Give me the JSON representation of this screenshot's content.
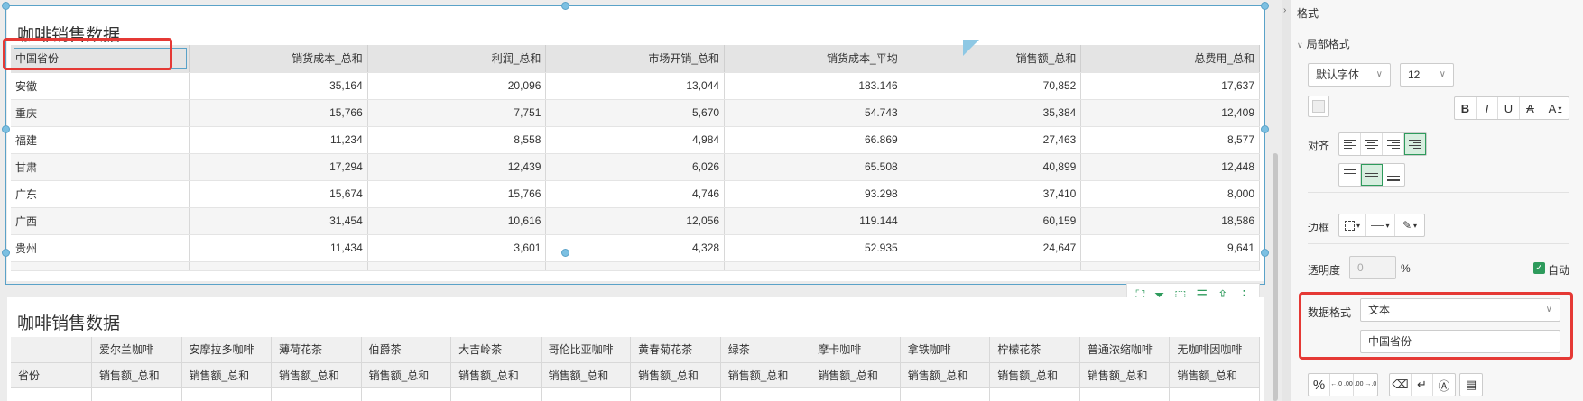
{
  "widget1": {
    "title": "咖啡销售数据",
    "columns": [
      "中国省份",
      "销货成本_总和",
      "利润_总和",
      "市场开销_总和",
      "销货成本_平均",
      "销售额_总和",
      "总费用_总和"
    ],
    "rows": [
      [
        "安徽",
        "35,164",
        "20,096",
        "13,044",
        "183.146",
        "70,852",
        "17,637"
      ],
      [
        "重庆",
        "15,766",
        "7,751",
        "5,670",
        "54.743",
        "35,384",
        "12,409"
      ],
      [
        "福建",
        "11,234",
        "8,558",
        "4,984",
        "66.869",
        "27,463",
        "8,577"
      ],
      [
        "甘肃",
        "17,294",
        "12,439",
        "6,026",
        "65.508",
        "40,899",
        "12,448"
      ],
      [
        "广东",
        "15,674",
        "15,766",
        "4,746",
        "93.298",
        "37,410",
        "8,000"
      ],
      [
        "广西",
        "31,454",
        "10,616",
        "12,056",
        "119.144",
        "60,159",
        "18,586"
      ],
      [
        "贵州",
        "11,434",
        "3,601",
        "4,328",
        "52.935",
        "24,647",
        "9,641"
      ]
    ]
  },
  "widget2": {
    "title": "咖啡销售数据",
    "products": [
      "爱尔兰咖啡",
      "安摩拉多咖啡",
      "薄荷花茶",
      "伯爵茶",
      "大吉岭茶",
      "哥伦比亚咖啡",
      "黄春菊花茶",
      "绿茶",
      "摩卡咖啡",
      "拿铁咖啡",
      "柠檬花茶",
      "普通浓缩咖啡",
      "无咖啡因咖啡"
    ],
    "row_header": "省份",
    "measure": "销售额_总和"
  },
  "panel": {
    "title": "格式",
    "section": "局部格式",
    "font_family": "默认字体",
    "font_size": "12",
    "bold": "B",
    "italic": "I",
    "underline": "U",
    "strike": "A",
    "font_color": "A",
    "align_label": "对齐",
    "border_label": "边框",
    "opacity_label": "透明度",
    "opacity_value": "0",
    "opacity_unit": "%",
    "auto_label": "自动",
    "data_format_label": "数据格式",
    "data_format_value": "文本",
    "text_value": "中国省份",
    "percent": "%",
    "dec_add": "←.0 .00",
    "dec_remove": ".00 →.0"
  },
  "colors": {
    "accent": "#2e9b5c",
    "selection": "#5aa2c8",
    "highlight": "#e53935"
  }
}
